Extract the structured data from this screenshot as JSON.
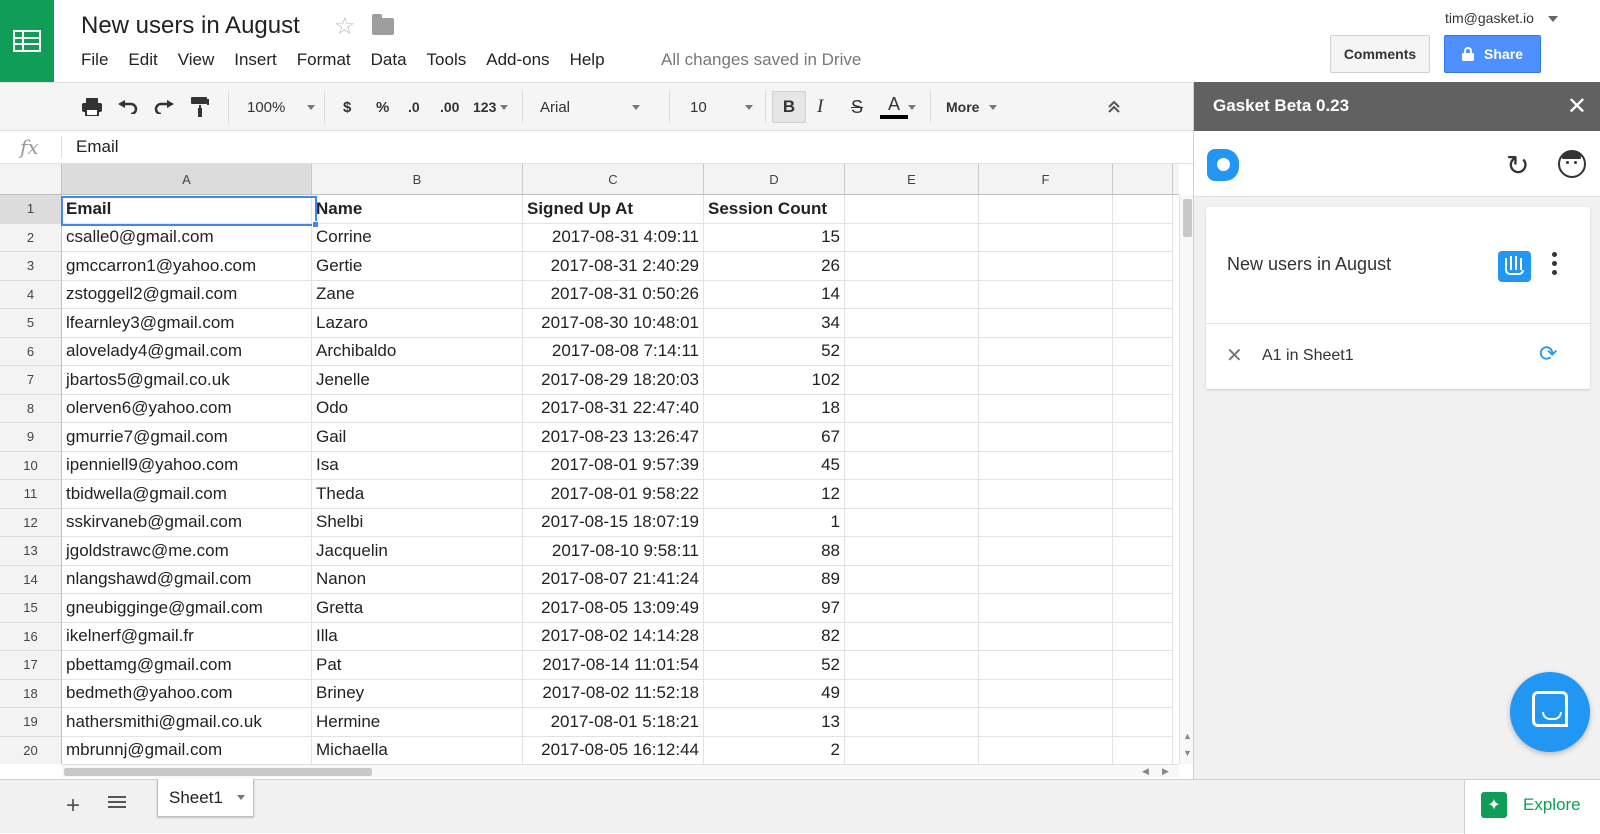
{
  "header": {
    "doc_title": "New users in August",
    "menus": [
      "File",
      "Edit",
      "View",
      "Insert",
      "Format",
      "Data",
      "Tools",
      "Add-ons",
      "Help"
    ],
    "save_status": "All changes saved in Drive",
    "user_email": "tim@gasket.io",
    "comments_label": "Comments",
    "share_label": "Share"
  },
  "toolbar": {
    "zoom": "100%",
    "currency": "$",
    "percent": "%",
    "dec_less": ".0",
    "dec_more": ".00",
    "number_format": "123",
    "font": "Arial",
    "font_size": "10",
    "bold": "B",
    "italic": "I",
    "strike": "S",
    "text_color": "A",
    "more": "More"
  },
  "formula_bar": {
    "fx": "fx",
    "value": "Email"
  },
  "grid": {
    "columns": [
      "A",
      "B",
      "C",
      "D",
      "E",
      "F"
    ],
    "rows": [
      [
        "Email",
        "Name",
        "Signed Up At",
        "Session Count"
      ],
      [
        "csalle0@gmail.com",
        "Corrine",
        "2017-08-31 4:09:11",
        "15"
      ],
      [
        "gmccarron1@yahoo.com",
        "Gertie",
        "2017-08-31 2:40:29",
        "26"
      ],
      [
        "zstoggell2@gmail.com",
        "Zane",
        "2017-08-31 0:50:26",
        "14"
      ],
      [
        "lfearnley3@gmail.com",
        "Lazaro",
        "2017-08-30 10:48:01",
        "34"
      ],
      [
        "alovelady4@gmail.com",
        "Archibaldo",
        "2017-08-08 7:14:11",
        "52"
      ],
      [
        "jbartos5@gmail.co.uk",
        "Jenelle",
        "2017-08-29 18:20:03",
        "102"
      ],
      [
        "olerven6@yahoo.com",
        "Odo",
        "2017-08-31 22:47:40",
        "18"
      ],
      [
        "gmurrie7@gmail.com",
        "Gail",
        "2017-08-23 13:26:47",
        "67"
      ],
      [
        "ipenniell9@yahoo.com",
        "Isa",
        "2017-08-01 9:57:39",
        "45"
      ],
      [
        "tbidwella@gmail.com",
        "Theda",
        "2017-08-01 9:58:22",
        "12"
      ],
      [
        "sskirvaneb@gmail.com",
        "Shelbi",
        "2017-08-15 18:07:19",
        "1"
      ],
      [
        "jgoldstrawc@me.com",
        "Jacquelin",
        "2017-08-10 9:58:11",
        "88"
      ],
      [
        "nlangshawd@gmail.com",
        "Nanon",
        "2017-08-07 21:41:24",
        "89"
      ],
      [
        "gneubigginge@gmail.com",
        "Gretta",
        "2017-08-05 13:09:49",
        "97"
      ],
      [
        "ikelnerf@gmail.fr",
        "Illa",
        "2017-08-02 14:14:28",
        "82"
      ],
      [
        "pbettamg@gmail.com",
        "Pat",
        "2017-08-14 11:01:54",
        "52"
      ],
      [
        "bedmeth@yahoo.com",
        "Briney",
        "2017-08-02 11:52:18",
        "49"
      ],
      [
        "hathersmithi@gmail.co.uk",
        "Hermine",
        "2017-08-01 5:18:21",
        "13"
      ],
      [
        "mbrunnj@gmail.com",
        "Michaella",
        "2017-08-05 16:12:44",
        "2"
      ]
    ]
  },
  "sheets": {
    "tabs": [
      "Sheet1"
    ],
    "explore_label": "Explore"
  },
  "panel": {
    "title": "Gasket Beta 0.23",
    "card_title": "New users in August",
    "range_label": "A1 in Sheet1"
  },
  "colors": {
    "sheets_green": "#0f9d58",
    "share_blue": "#4d90fe",
    "gasket_blue": "#2196f3",
    "panel_header": "#616161"
  }
}
